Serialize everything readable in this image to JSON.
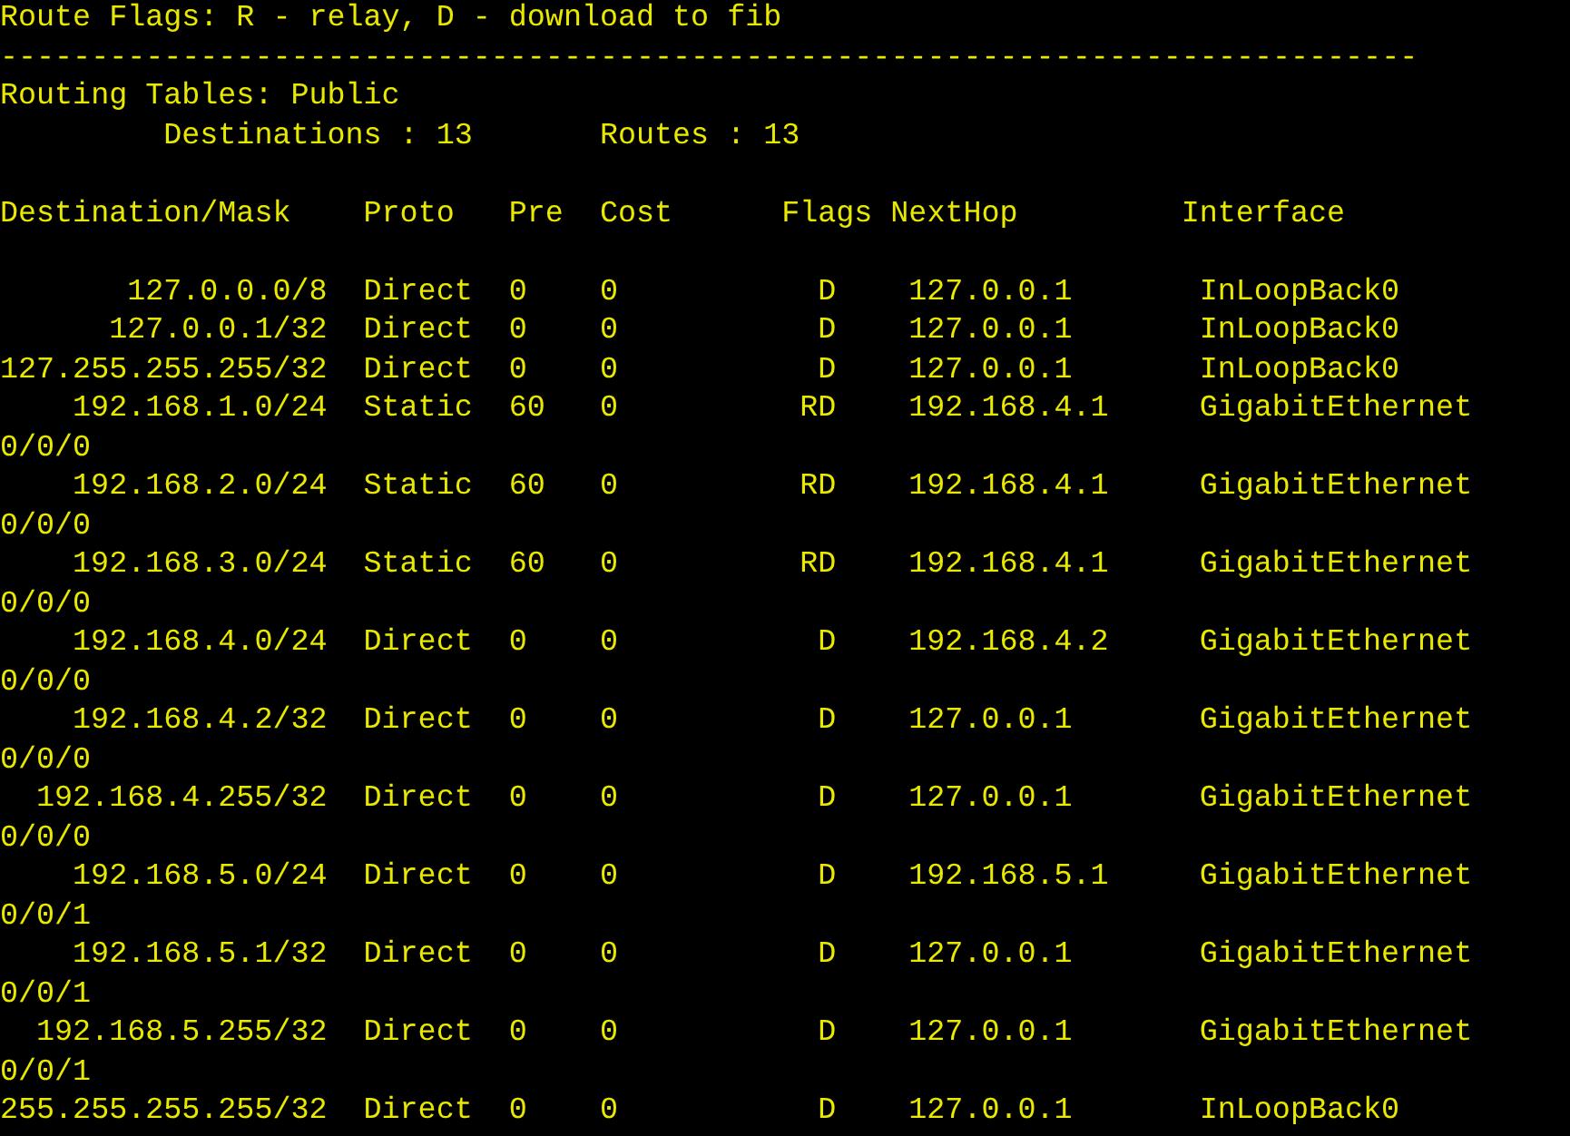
{
  "legend": "Route Flags: R - relay, D - download to fib",
  "separator": "------------------------------------------------------------------------------",
  "table_title": "Routing Tables: Public",
  "summary": {
    "destinations_label": "Destinations : 13",
    "routes_label": "Routes : 13"
  },
  "columns": [
    "Destination/Mask",
    "Proto",
    "Pre",
    "Cost",
    "Flags",
    "NextHop",
    "Interface"
  ],
  "rows": [
    {
      "destination": "127.0.0.0/8",
      "proto": "Direct",
      "pre": "0",
      "cost": "0",
      "flags": "D",
      "nexthop": "127.0.0.1",
      "interface": "InLoopBack0"
    },
    {
      "destination": "127.0.0.1/32",
      "proto": "Direct",
      "pre": "0",
      "cost": "0",
      "flags": "D",
      "nexthop": "127.0.0.1",
      "interface": "InLoopBack0"
    },
    {
      "destination": "127.255.255.255/32",
      "proto": "Direct",
      "pre": "0",
      "cost": "0",
      "flags": "D",
      "nexthop": "127.0.0.1",
      "interface": "InLoopBack0"
    },
    {
      "destination": "192.168.1.0/24",
      "proto": "Static",
      "pre": "60",
      "cost": "0",
      "flags": "RD",
      "nexthop": "192.168.4.1",
      "interface": "GigabitEthernet",
      "interface_wrap": "0/0/0"
    },
    {
      "destination": "192.168.2.0/24",
      "proto": "Static",
      "pre": "60",
      "cost": "0",
      "flags": "RD",
      "nexthop": "192.168.4.1",
      "interface": "GigabitEthernet",
      "interface_wrap": "0/0/0"
    },
    {
      "destination": "192.168.3.0/24",
      "proto": "Static",
      "pre": "60",
      "cost": "0",
      "flags": "RD",
      "nexthop": "192.168.4.1",
      "interface": "GigabitEthernet",
      "interface_wrap": "0/0/0"
    },
    {
      "destination": "192.168.4.0/24",
      "proto": "Direct",
      "pre": "0",
      "cost": "0",
      "flags": "D",
      "nexthop": "192.168.4.2",
      "interface": "GigabitEthernet",
      "interface_wrap": "0/0/0"
    },
    {
      "destination": "192.168.4.2/32",
      "proto": "Direct",
      "pre": "0",
      "cost": "0",
      "flags": "D",
      "nexthop": "127.0.0.1",
      "interface": "GigabitEthernet",
      "interface_wrap": "0/0/0"
    },
    {
      "destination": "192.168.4.255/32",
      "proto": "Direct",
      "pre": "0",
      "cost": "0",
      "flags": "D",
      "nexthop": "127.0.0.1",
      "interface": "GigabitEthernet",
      "interface_wrap": "0/0/0"
    },
    {
      "destination": "192.168.5.0/24",
      "proto": "Direct",
      "pre": "0",
      "cost": "0",
      "flags": "D",
      "nexthop": "192.168.5.1",
      "interface": "GigabitEthernet",
      "interface_wrap": "0/0/1"
    },
    {
      "destination": "192.168.5.1/32",
      "proto": "Direct",
      "pre": "0",
      "cost": "0",
      "flags": "D",
      "nexthop": "127.0.0.1",
      "interface": "GigabitEthernet",
      "interface_wrap": "0/0/1"
    },
    {
      "destination": "192.168.5.255/32",
      "proto": "Direct",
      "pre": "0",
      "cost": "0",
      "flags": "D",
      "nexthop": "127.0.0.1",
      "interface": "GigabitEthernet",
      "interface_wrap": "0/0/1"
    },
    {
      "destination": "255.255.255.255/32",
      "proto": "Direct",
      "pre": "0",
      "cost": "0",
      "flags": "D",
      "nexthop": "127.0.0.1",
      "interface": "InLoopBack0"
    }
  ]
}
